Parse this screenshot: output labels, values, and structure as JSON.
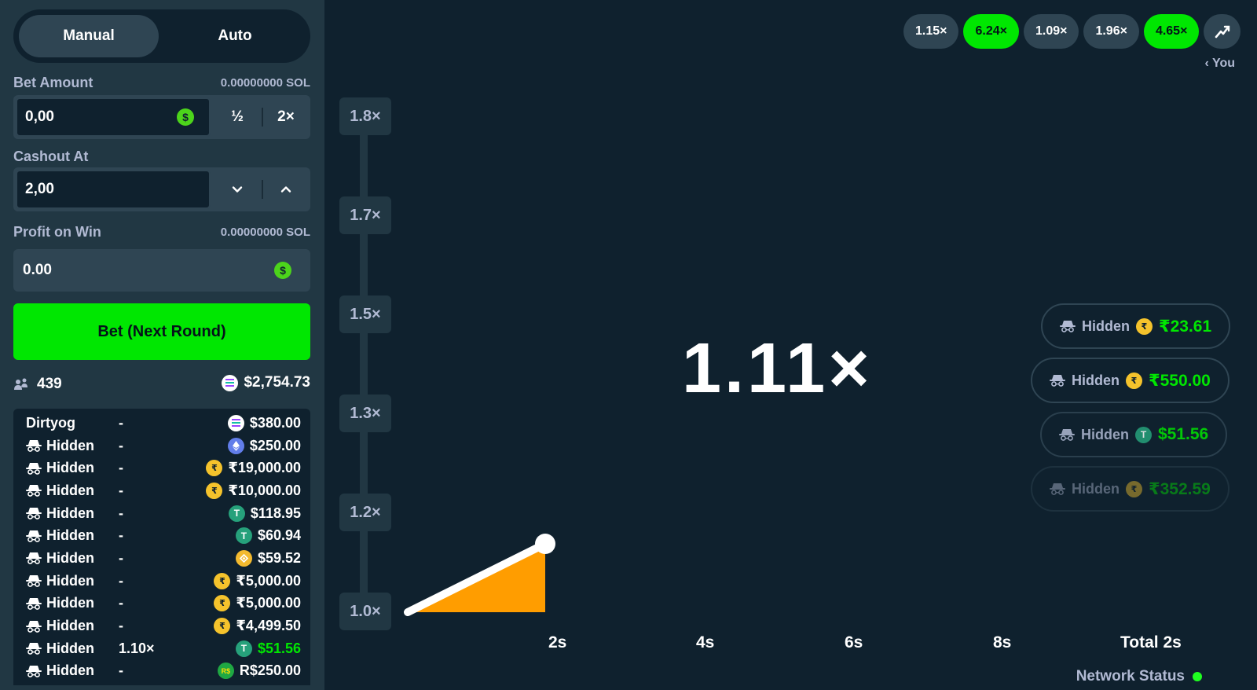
{
  "modes": {
    "manual": "Manual",
    "auto": "Auto"
  },
  "bet_amount": {
    "label": "Bet Amount",
    "crypto": "0.00000000 SOL",
    "value": "0,00",
    "half": "½",
    "double": "2×"
  },
  "cashout_at": {
    "label": "Cashout At",
    "value": "2,00"
  },
  "profit": {
    "label": "Profit on Win",
    "crypto": "0.00000000 SOL",
    "value": "0.00"
  },
  "bet_button": "Bet (Next Round)",
  "stats": {
    "players": "439",
    "total": "$2,754.73"
  },
  "bets": [
    {
      "user": "Dirtyog",
      "hidden": false,
      "cashout": "-",
      "amount": "$380.00",
      "currency": "sol",
      "won": false
    },
    {
      "user": "Hidden",
      "hidden": true,
      "cashout": "-",
      "amount": "$250.00",
      "currency": "eth",
      "won": false
    },
    {
      "user": "Hidden",
      "hidden": true,
      "cashout": "-",
      "amount": "₹19,000.00",
      "currency": "inr",
      "won": false
    },
    {
      "user": "Hidden",
      "hidden": true,
      "cashout": "-",
      "amount": "₹10,000.00",
      "currency": "inr",
      "won": false
    },
    {
      "user": "Hidden",
      "hidden": true,
      "cashout": "-",
      "amount": "$118.95",
      "currency": "usdt",
      "won": false
    },
    {
      "user": "Hidden",
      "hidden": true,
      "cashout": "-",
      "amount": "$60.94",
      "currency": "usdt",
      "won": false
    },
    {
      "user": "Hidden",
      "hidden": true,
      "cashout": "-",
      "amount": "$59.52",
      "currency": "bnb",
      "won": false
    },
    {
      "user": "Hidden",
      "hidden": true,
      "cashout": "-",
      "amount": "₹5,000.00",
      "currency": "inr",
      "won": false
    },
    {
      "user": "Hidden",
      "hidden": true,
      "cashout": "-",
      "amount": "₹5,000.00",
      "currency": "inr",
      "won": false
    },
    {
      "user": "Hidden",
      "hidden": true,
      "cashout": "-",
      "amount": "₹4,499.50",
      "currency": "inr",
      "won": false
    },
    {
      "user": "Hidden",
      "hidden": true,
      "cashout": "1.10×",
      "amount": "$51.56",
      "currency": "usdt",
      "won": true
    },
    {
      "user": "Hidden",
      "hidden": true,
      "cashout": "-",
      "amount": "R$250.00",
      "currency": "brl",
      "won": false
    }
  ],
  "history": [
    {
      "value": "1.15×",
      "green": false
    },
    {
      "value": "6.24×",
      "green": true
    },
    {
      "value": "1.09×",
      "green": false
    },
    {
      "value": "1.96×",
      "green": false
    },
    {
      "value": "4.65×",
      "green": true
    }
  ],
  "you_label": "You",
  "current_multiplier": "1.11×",
  "y_ticks": [
    "1.8×",
    "1.7×",
    "1.5×",
    "1.3×",
    "1.2×",
    "1.0×"
  ],
  "x_ticks": [
    "2s",
    "4s",
    "6s",
    "8s",
    "Total 2s"
  ],
  "recent_cashouts": [
    {
      "user": "Hidden",
      "amount": "₹23.61",
      "currency": "inr"
    },
    {
      "user": "Hidden",
      "amount": "₹550.00",
      "currency": "inr"
    },
    {
      "user": "Hidden",
      "amount": "$51.56",
      "currency": "usdt"
    },
    {
      "user": "Hidden",
      "amount": "₹352.59",
      "currency": "inr"
    }
  ],
  "network_status": "Network Status",
  "colors": {
    "accent": "#00e701",
    "sidebar": "#213743",
    "bg": "#0f212e",
    "curve_fill": "#ff9d00"
  },
  "icons": {
    "players": "users-icon",
    "hidden": "incognito-icon",
    "history_chart": "chart-trend-icon",
    "coin": "dollar-coin-icon"
  }
}
